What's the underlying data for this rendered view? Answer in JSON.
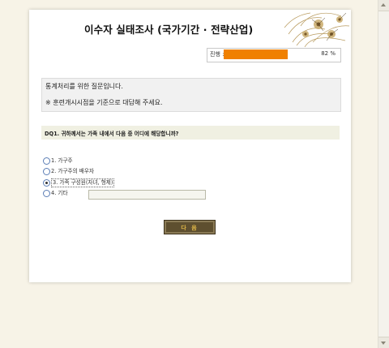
{
  "survey": {
    "title": "이수자 실태조사 (국가기간 · 전략산업)",
    "progress": {
      "label": "진행 :",
      "value_percent": 82,
      "display": "82 %",
      "fill_color": "#f08000"
    },
    "notice": {
      "line1": "통계처리를 위한 질문입니다.",
      "line2": "※ 훈련개시시점을 기준으로 대답해 주세요."
    },
    "question": {
      "text": "DQ1. 귀하께서는 가족 내에서 다음 중 어디에 해당합니까?"
    },
    "options": [
      {
        "label": "1. 가구주",
        "checked": false
      },
      {
        "label": "2. 가구주의 배우자",
        "checked": false
      },
      {
        "label": "3. 가족 구성원(자녀, 형제)",
        "checked": true
      },
      {
        "label": "4. 기타",
        "checked": false
      }
    ],
    "other_input_value": "",
    "next_button": "다 음",
    "button_color": "#5e4f2f"
  }
}
